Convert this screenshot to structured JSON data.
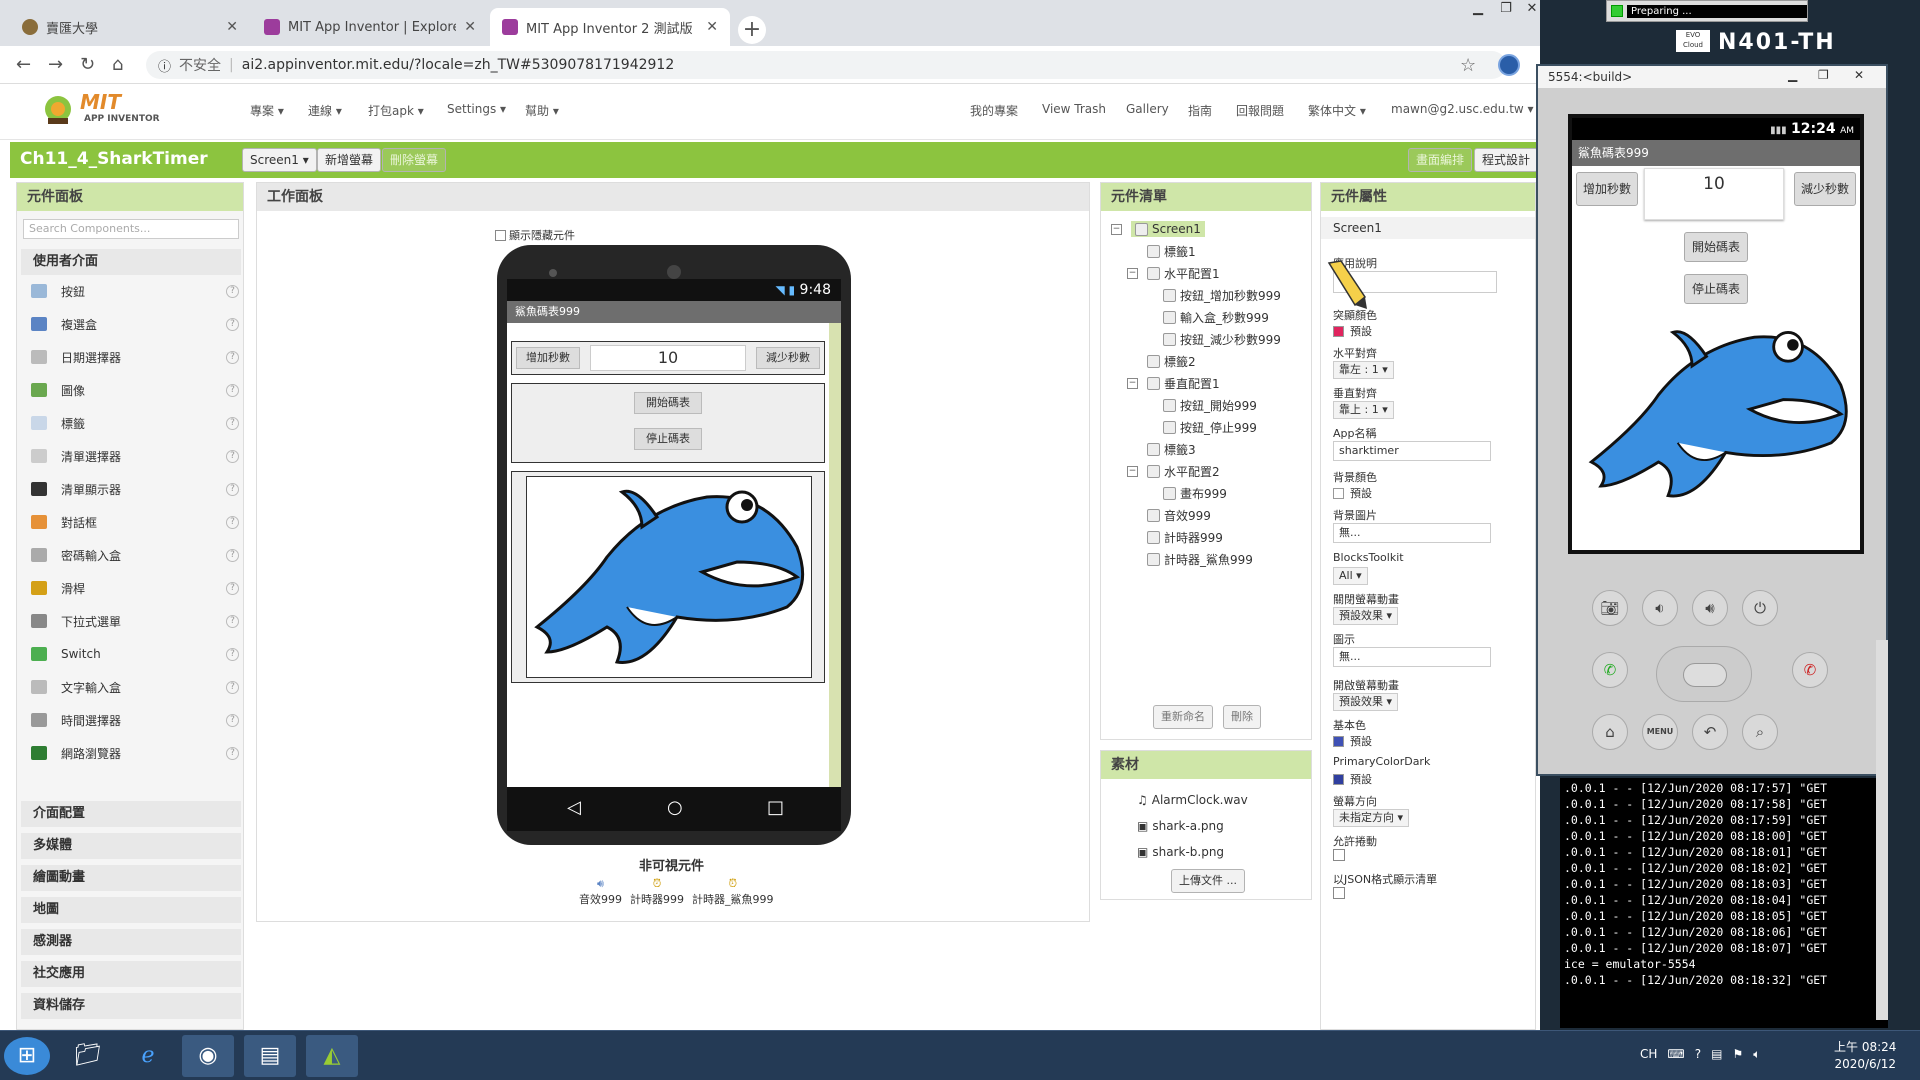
{
  "browser": {
    "tabs": [
      {
        "label": "賣匯大學",
        "color": "#8a6d3b"
      },
      {
        "label": "MIT App Inventor | Explore MIT",
        "color": "#9c3c9c"
      },
      {
        "label": "MIT App Inventor 2 測試版",
        "color": "#9c3c9c"
      }
    ],
    "new_tab": "+",
    "security": "不安全",
    "url": "ai2.appinventor.mit.edu/?locale=zh_TW#5309078171942912"
  },
  "header": {
    "logo_mit": "MIT",
    "logo_sub": "APP INVENTOR",
    "menus": [
      "專案 ▾",
      "連線 ▾",
      "打包apk ▾",
      "Settings ▾",
      "幫助 ▾"
    ],
    "right_menus": [
      "我的專案",
      "View Trash",
      "Gallery",
      "指南",
      "回報問題",
      "繁体中文 ▾",
      "mawn@g2.usc.edu.tw ▾"
    ]
  },
  "project": {
    "name": "Ch11_4_SharkTimer",
    "screen_select": "Screen1 ▾",
    "add_screen": "新增螢幕",
    "remove_screen": "刪除螢幕",
    "designer": "畫面編排",
    "blocks": "程式設計"
  },
  "palette": {
    "title": "元件面板",
    "search_placeholder": "Search Components...",
    "ui_category": "使用者介面",
    "items": [
      {
        "label": "按鈕",
        "color": "#9ab8d8"
      },
      {
        "label": "複選盒",
        "color": "#5b84c4"
      },
      {
        "label": "日期選擇器",
        "color": "#bbbbbb"
      },
      {
        "label": "圖像",
        "color": "#6aa84f"
      },
      {
        "label": "標籤",
        "color": "#c9d7e8"
      },
      {
        "label": "清單選擇器",
        "color": "#cccccc"
      },
      {
        "label": "清單顯示器",
        "color": "#333333"
      },
      {
        "label": "對話框",
        "color": "#e69138"
      },
      {
        "label": "密碼輸入盒",
        "color": "#aaaaaa"
      },
      {
        "label": "滑桿",
        "color": "#d4a017"
      },
      {
        "label": "下拉式選單",
        "color": "#888888"
      },
      {
        "label": "Switch",
        "color": "#4caf50"
      },
      {
        "label": "文字輸入盒",
        "color": "#bbbbbb"
      },
      {
        "label": "時間選擇器",
        "color": "#999999"
      },
      {
        "label": "網路瀏覽器",
        "color": "#2e7d32"
      }
    ],
    "categories": [
      "介面配置",
      "多媒體",
      "繪圖動畫",
      "地圖",
      "感測器",
      "社交應用",
      "資料儲存"
    ]
  },
  "viewer": {
    "title": "工作面板",
    "show_hidden": "顯示隱藏元件",
    "status_time": "9:48",
    "app_title": "鯊魚碼表999",
    "btn_add": "增加秒數",
    "seconds_value": "10",
    "btn_minus": "減少秒數",
    "btn_start": "開始碼表",
    "btn_stop": "停止碼表",
    "nonvisible_title": "非可視元件",
    "nonvisible": [
      "音效999",
      "計時器999",
      "計時器_鯊魚999"
    ]
  },
  "tree": {
    "title": "元件清單",
    "nodes": [
      {
        "label": "Screen1",
        "level": 0,
        "toggle": "⊟",
        "selected": true
      },
      {
        "label": "標籤1",
        "level": 1
      },
      {
        "label": "水平配置1",
        "level": 1,
        "toggle": "⊟"
      },
      {
        "label": "按鈕_增加秒數999",
        "level": 2
      },
      {
        "label": "輸入盒_秒數999",
        "level": 2
      },
      {
        "label": "按鈕_減少秒數999",
        "level": 2
      },
      {
        "label": "標籤2",
        "level": 1
      },
      {
        "label": "垂直配置1",
        "level": 1,
        "toggle": "⊟"
      },
      {
        "label": "按鈕_開始999",
        "level": 2
      },
      {
        "label": "按鈕_停止999",
        "level": 2
      },
      {
        "label": "標籤3",
        "level": 1
      },
      {
        "label": "水平配置2",
        "level": 1,
        "toggle": "⊟"
      },
      {
        "label": "畫布999",
        "level": 2
      },
      {
        "label": "音效999",
        "level": 1
      },
      {
        "label": "計時器999",
        "level": 1
      },
      {
        "label": "計時器_鯊魚999",
        "level": 1
      }
    ],
    "rename": "重新命名",
    "delete": "刪除"
  },
  "media": {
    "title": "素材",
    "files": [
      "AlarmClock.wav",
      "shark-a.png",
      "shark-b.png"
    ],
    "upload": "上傳文件 ..."
  },
  "props": {
    "title": "元件屬性",
    "component": "Screen1",
    "about_label": "應用說明",
    "accent_label": "突顯顏色",
    "accent_value": "預設",
    "align_h_label": "水平對齊",
    "align_h_value": "靠左 : 1 ▾",
    "align_v_label": "垂直對齊",
    "align_v_value": "靠上 : 1 ▾",
    "appname_label": "App名稱",
    "appname_value": "sharktimer",
    "bgcolor_label": "背景顏色",
    "bgcolor_value": "預設",
    "bgimage_label": "背景圖片",
    "bgimage_value": "無...",
    "toolkit_label": "BlocksToolkit",
    "toolkit_value": "All ▾",
    "close_anim_label": "關閉螢幕動畫",
    "close_anim_value": "預設效果 ▾",
    "icon_label": "圖示",
    "icon_value": "無...",
    "open_anim_label": "開啟螢幕動畫",
    "open_anim_value": "預設效果 ▾",
    "primary_label": "基本色",
    "primary_value": "預設",
    "primary_dark_label": "PrimaryColorDark",
    "primary_dark_value": "預設",
    "orientation_label": "螢幕方向",
    "orientation_value": "未指定方向 ▾",
    "scroll_label": "允許捲動",
    "json_label": "以JSON格式顯示清單"
  },
  "emulator": {
    "title": "5554:<build>",
    "time": "12:24",
    "ampm": "AM",
    "app_title": "鯊魚碼表999",
    "btn_add": "增加秒數",
    "seconds_value": "10",
    "btn_minus": "減少秒數",
    "btn_start": "開始碼表",
    "btn_stop": "停止碼表",
    "menu_key": "MENU"
  },
  "console": {
    "lines": [
      ".0.0.1 - - [12/Jun/2020 08:17:57] \"GET",
      ".0.0.1 - - [12/Jun/2020 08:17:58] \"GET",
      ".0.0.1 - - [12/Jun/2020 08:17:59] \"GET",
      ".0.0.1 - - [12/Jun/2020 08:18:00] \"GET",
      ".0.0.1 - - [12/Jun/2020 08:18:01] \"GET",
      ".0.0.1 - - [12/Jun/2020 08:18:02] \"GET",
      ".0.0.1 - - [12/Jun/2020 08:18:03] \"GET",
      ".0.0.1 - - [12/Jun/2020 08:18:04] \"GET",
      ".0.0.1 - - [12/Jun/2020 08:18:05] \"GET",
      ".0.0.1 - - [12/Jun/2020 08:18:06] \"GET",
      ".0.0.1 - - [12/Jun/2020 08:18:07] \"GET",
      "ice = emulator-5554",
      ".0.0.1 - - [12/Jun/2020 08:18:32] \"GET"
    ]
  },
  "desktop": {
    "preparing": "Preparing ...",
    "evo_badge": "EVO Cloud",
    "hostname": "N401-TH",
    "tray_lang": "CH",
    "clock_time": "上午 08:24",
    "clock_date": "2020/6/12"
  }
}
